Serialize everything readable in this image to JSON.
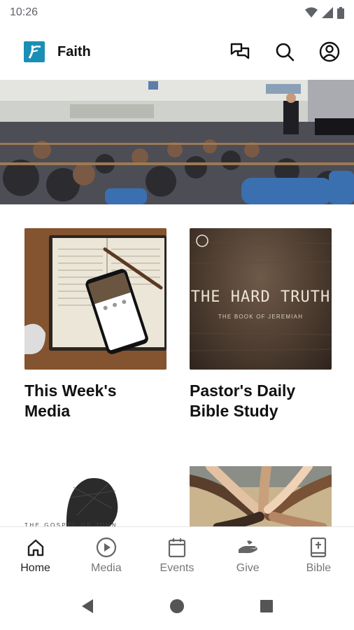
{
  "status_bar": {
    "time": "10:26"
  },
  "app_bar": {
    "title": "Faith",
    "logo_icon": "church-logo-icon",
    "actions": [
      "chat-icon",
      "search-icon",
      "account-icon"
    ]
  },
  "cards": [
    {
      "title": "This Week's Media"
    },
    {
      "title": "Pastor's Daily Bible Study",
      "image_text": {
        "heading": "THE HARD TRUTH",
        "subheading": "THE BOOK OF JEREMIAH"
      }
    },
    {
      "image_text": "THE GOSPEL OF JOHN"
    },
    {}
  ],
  "bottom_nav": {
    "items": [
      {
        "label": "Home",
        "icon": "home-icon",
        "active": true
      },
      {
        "label": "Media",
        "icon": "play-circle-icon",
        "active": false
      },
      {
        "label": "Events",
        "icon": "calendar-icon",
        "active": false
      },
      {
        "label": "Give",
        "icon": "give-hand-icon",
        "active": false
      },
      {
        "label": "Bible",
        "icon": "bible-icon",
        "active": false
      }
    ]
  },
  "colors": {
    "accent": "#1a8fb5",
    "text": "#111111",
    "inactive": "#777777"
  }
}
